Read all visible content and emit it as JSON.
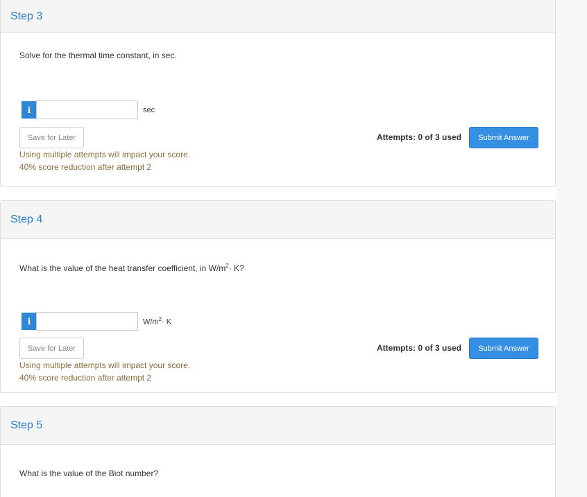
{
  "steps": [
    {
      "title": "Step 3",
      "question": "Solve for the thermal time constant, in sec.",
      "info_icon": "i",
      "input_value": "",
      "unit": "sec",
      "save_label": "Save for Later",
      "attempts": "Attempts: 0 of 3 used",
      "submit_label": "Submit Answer",
      "warning_line1": "Using multiple attempts will impact your score.",
      "warning_line2": "40% score reduction after attempt 2"
    },
    {
      "title": "Step 4",
      "question_prefix": "What is the value of the heat transfer coefficient, in W/m",
      "question_sup": "2",
      "question_suffix": "· K?",
      "info_icon": "i",
      "input_value": "",
      "unit_prefix": "W/m",
      "unit_sup": "2",
      "unit_suffix": "· K",
      "save_label": "Save for Later",
      "attempts": "Attempts: 0 of 3 used",
      "submit_label": "Submit Answer",
      "warning_line1": "Using multiple attempts will impact your score.",
      "warning_line2": "40% score reduction after attempt 2"
    },
    {
      "title": "Step 5",
      "question": "What is the value of the Biot number?"
    }
  ],
  "colors": {
    "title": "#2a7fc2",
    "info_button": "#2f86d6",
    "submit_button": "#3590e3",
    "warning_text": "#8a6d3b",
    "header_bg": "#f5f5f5"
  }
}
